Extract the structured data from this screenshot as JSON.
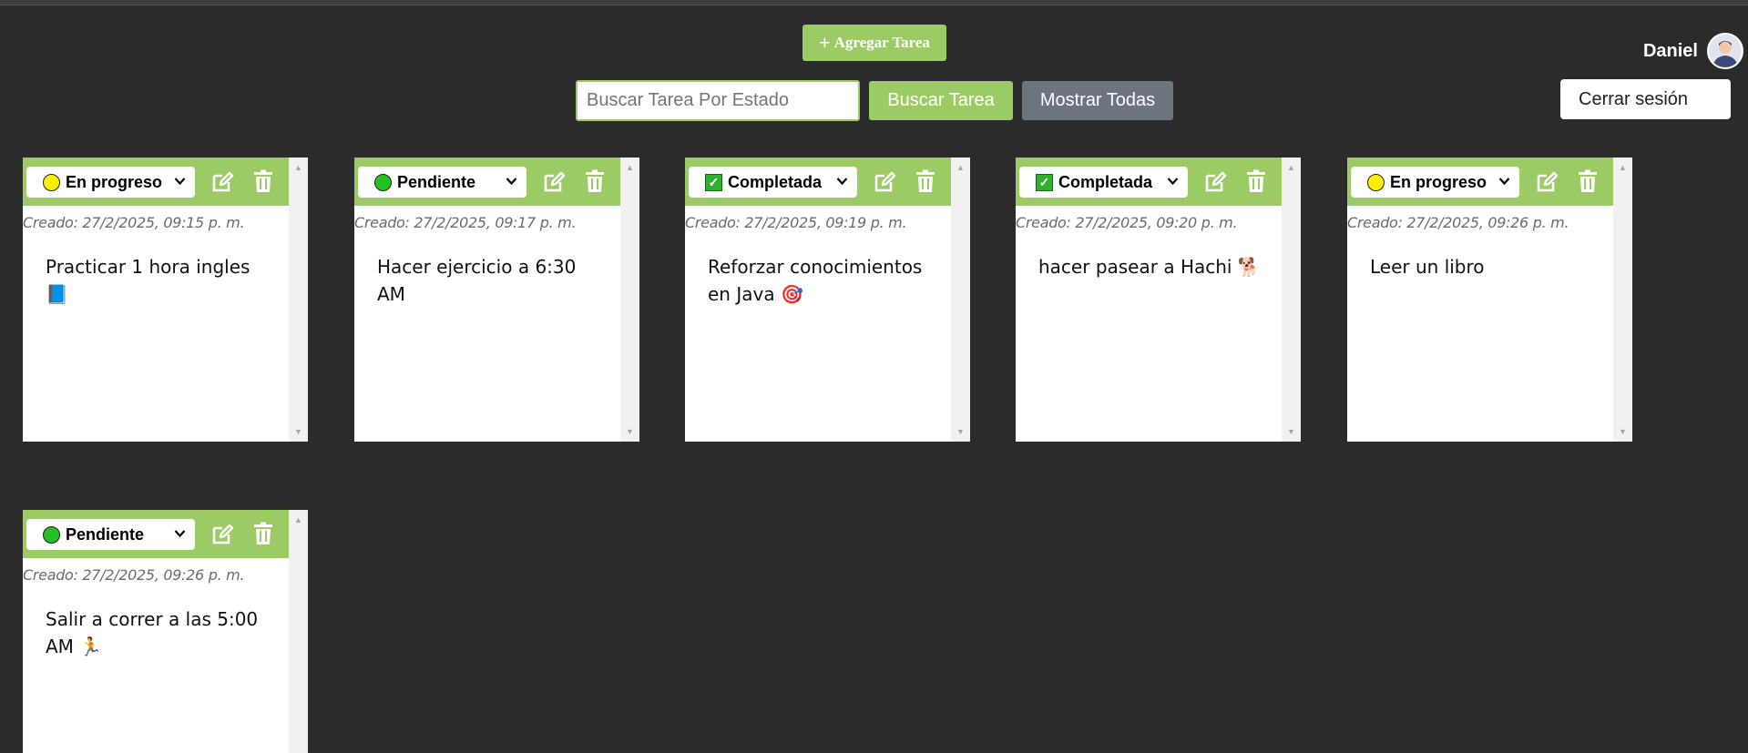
{
  "toolbar": {
    "add_plus": "+",
    "add_label": "Agregar Tarea",
    "search_placeholder": "Buscar Tarea Por Estado",
    "search_label": "Buscar Tarea",
    "show_all_label": "Mostrar Todas"
  },
  "user": {
    "name": "Daniel",
    "logout_label": "Cerrar sesión"
  },
  "colors": {
    "accent": "#9ccb66",
    "secondary": "#6c757d",
    "background": "#2b2b2b",
    "in_progress": "#ffee00",
    "pending": "#22c022",
    "completed": "#2fb12f"
  },
  "tasks": [
    {
      "status": "En progreso",
      "status_icon": "yellow-circle-icon",
      "created": "Creado: 27/2/2025, 09:15 p. m.",
      "text": "Practicar 1 hora ingles 📘"
    },
    {
      "status": "Pendiente",
      "status_icon": "green-circle-icon",
      "created": "Creado: 27/2/2025, 09:17 p. m.",
      "text": "Hacer ejercicio a 6:30 AM"
    },
    {
      "status": "Completada",
      "status_icon": "check-box-icon",
      "created": "Creado: 27/2/2025, 09:19 p. m.",
      "text": "Reforzar conocimientos en Java 🎯"
    },
    {
      "status": "Completada",
      "status_icon": "check-box-icon",
      "created": "Creado: 27/2/2025, 09:20 p. m.",
      "text": "hacer pasear a Hachi 🐕"
    },
    {
      "status": "En progreso",
      "status_icon": "yellow-circle-icon",
      "created": "Creado: 27/2/2025, 09:26 p. m.",
      "text": "Leer un libro"
    },
    {
      "status": "Pendiente",
      "status_icon": "green-circle-icon",
      "created": "Creado: 27/2/2025, 09:26 p. m.",
      "text": "Salir a correr a las 5:00 AM 🏃"
    }
  ]
}
